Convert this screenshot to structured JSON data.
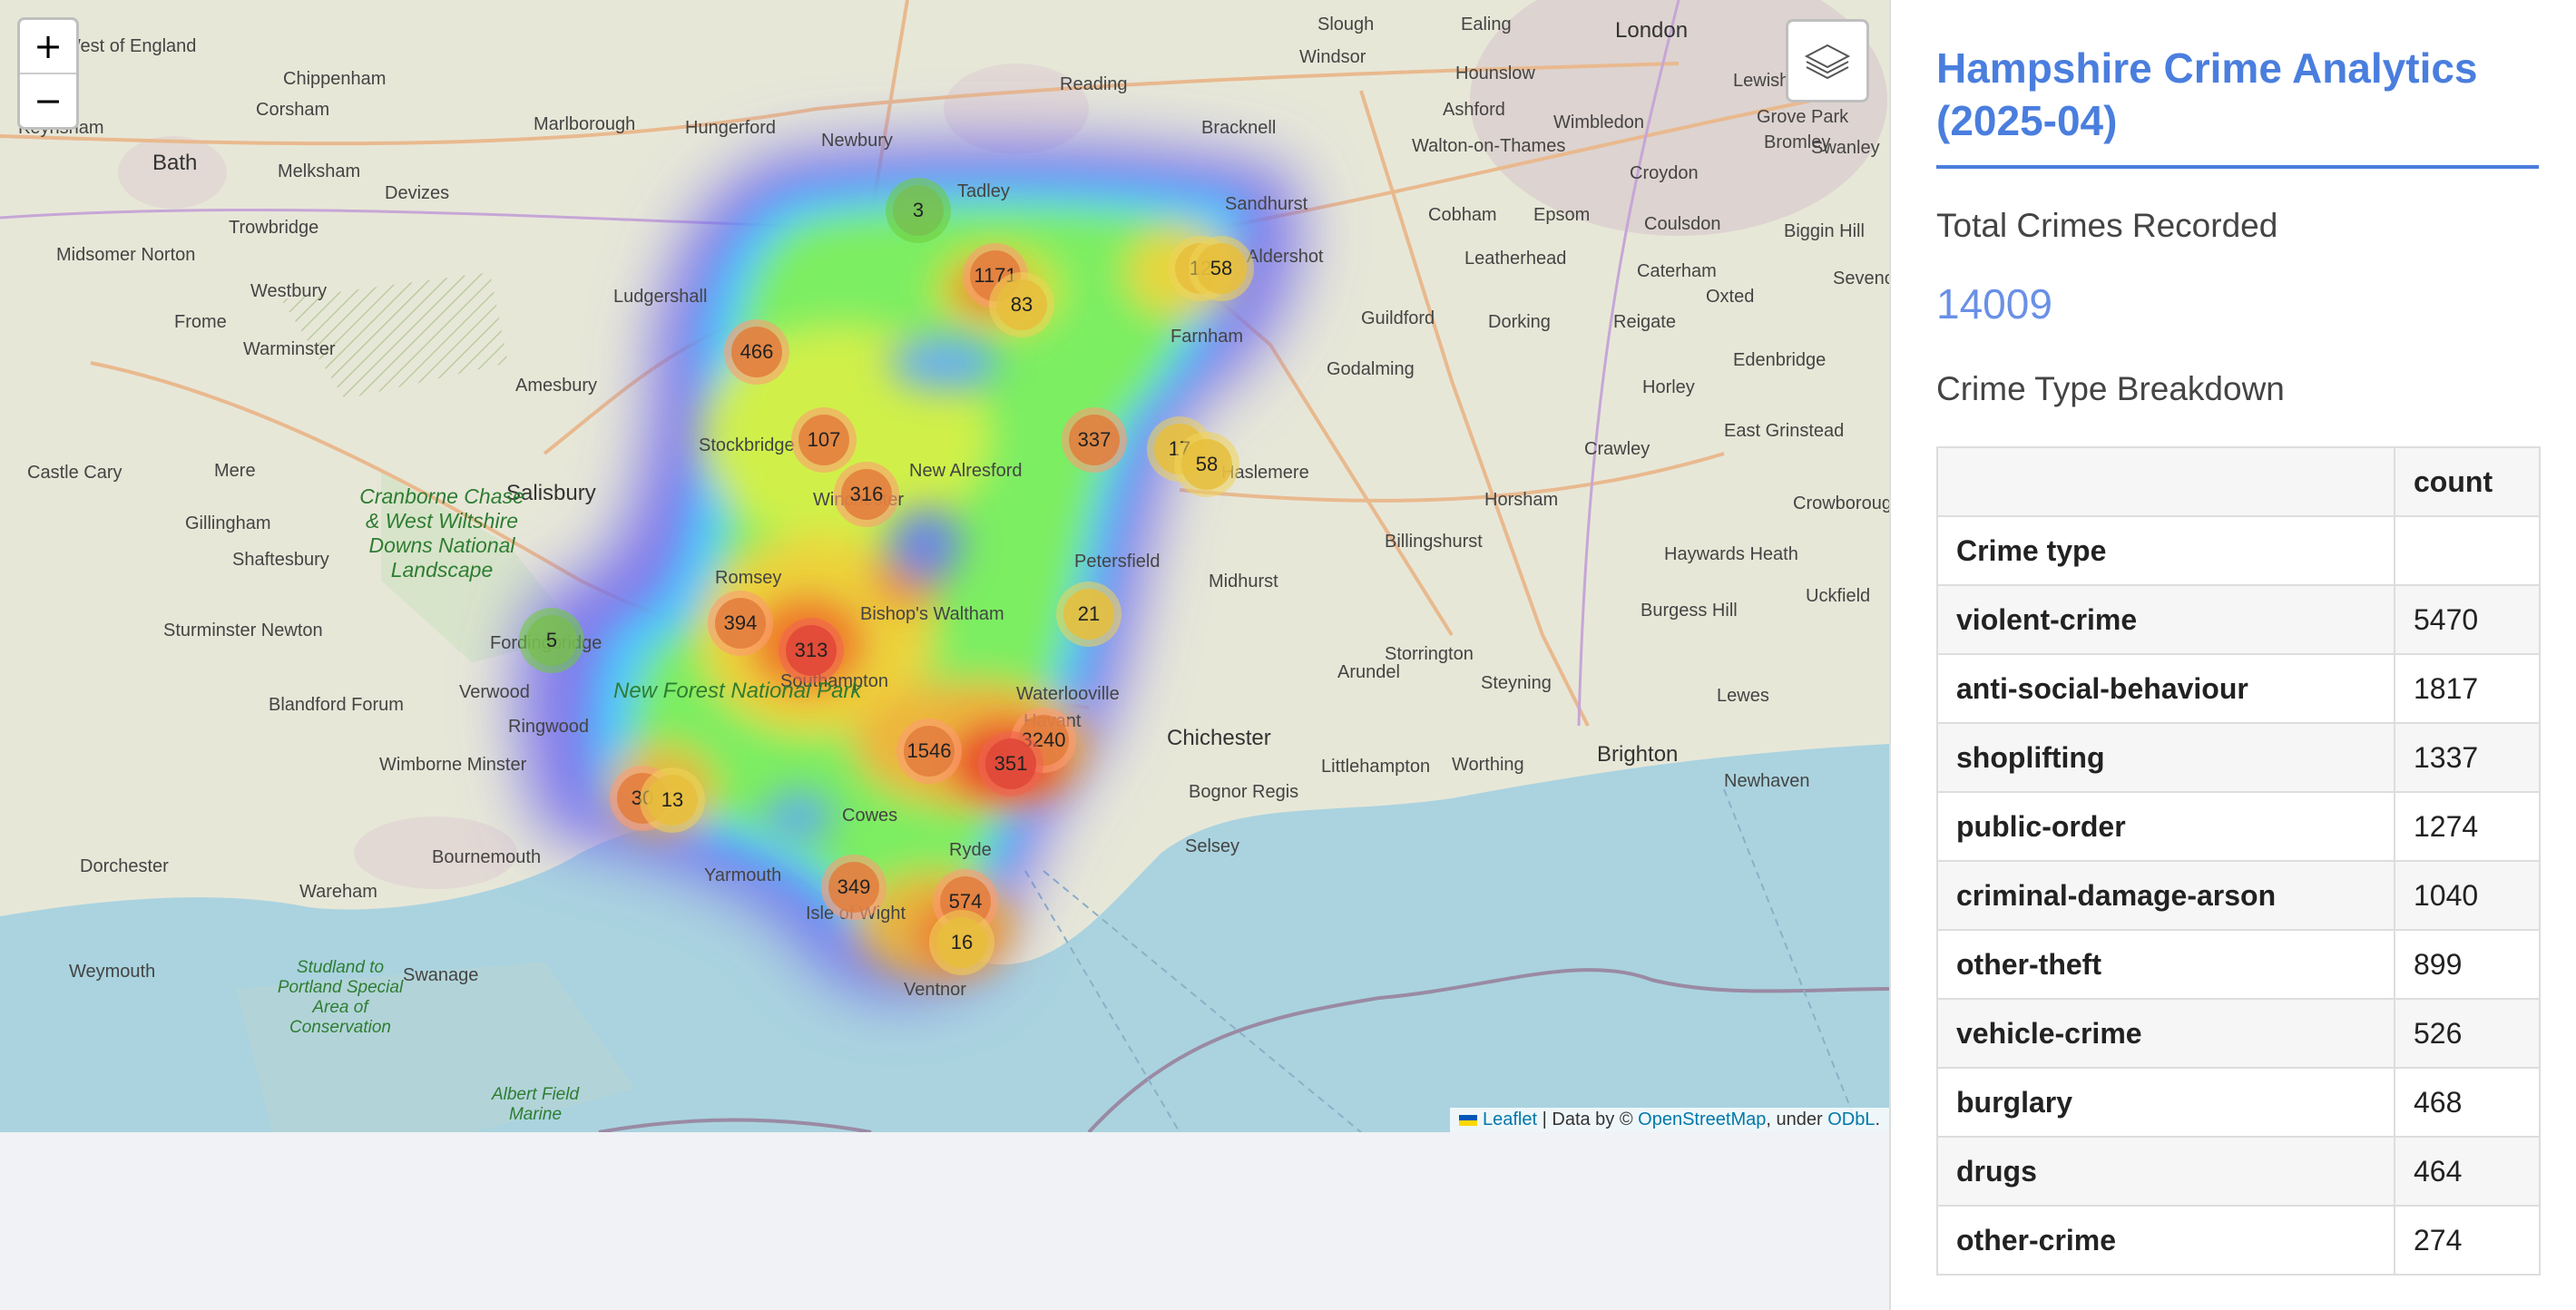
{
  "map": {
    "zoom_in": "+",
    "zoom_out": "−",
    "layers_icon": "layers-icon",
    "places": [
      "London",
      "Ealing",
      "Slough",
      "Windsor",
      "Hounslow",
      "Wimbledon",
      "Croydon",
      "Reading",
      "Newbury",
      "Bracknell",
      "Ashford",
      "Walton-on-Thames",
      "Lewisham",
      "Grove Park",
      "Bromley",
      "Swanley",
      "Chippenham",
      "Corsham",
      "Marlborough",
      "Hungerford",
      "Tadley",
      "Sandhurst",
      "Aldershot",
      "Farnham",
      "Guildford",
      "Godalming",
      "Cobham",
      "Epsom",
      "Leatherhead",
      "Dorking",
      "Reigate",
      "Coulsdon",
      "Caterham",
      "Oxted",
      "Biggin Hill",
      "Sevenoaks",
      "Edenbridge",
      "Horley",
      "East Grinstead",
      "Crawley",
      "Crowborough",
      "Bath",
      "Melksham",
      "Devizes",
      "Trowbridge",
      "Midsomer Norton",
      "Westbury",
      "Frome",
      "Warminster",
      "Ludgershall",
      "Amesbury",
      "Salisbury",
      "Stockbridge",
      "New Alresford",
      "Winchester",
      "Romsey",
      "Bishop's Waltham",
      "Petersfield",
      "Haslemere",
      "Midhurst",
      "Horsham",
      "Billingshurst",
      "Haywards Heath",
      "Burgess Hill",
      "Uckfield",
      "Lewes",
      "Steyning",
      "Storrington",
      "Chichester",
      "Arundel",
      "Littlehampton",
      "Worthing",
      "Brighton",
      "Newhaven",
      "Bognor Regis",
      "Selsey",
      "Castle Cary",
      "Mere",
      "Gillingham",
      "Shaftesbury",
      "Sturminster Newton",
      "Blandford Forum",
      "Verwood",
      "Ringwood",
      "Fordingbridge",
      "Wimborne Minster",
      "Bournemouth",
      "Dorchester",
      "Wareham",
      "Swanage",
      "Weymouth",
      "Yarmouth",
      "Cowes",
      "Ryde",
      "Ventnor",
      "Isle of Wight",
      "Waterlooville",
      "Havant",
      "Southampton",
      "New Forest National Park",
      "Cranborne Chase & West Wiltshire Downs National Landscape",
      "Studland to Portland Special Area of Conservation",
      "Albert Field Marine",
      "West of England",
      "Keynsham"
    ],
    "clusters": [
      {
        "label": "3",
        "level": "low"
      },
      {
        "label": "1171",
        "level": "high"
      },
      {
        "label": "83",
        "level": "med"
      },
      {
        "label": "12",
        "level": "med"
      },
      {
        "label": "58",
        "level": "med"
      },
      {
        "label": "466",
        "level": "high"
      },
      {
        "label": "107",
        "level": "high"
      },
      {
        "label": "316",
        "level": "high"
      },
      {
        "label": "337",
        "level": "high"
      },
      {
        "label": "17",
        "level": "med"
      },
      {
        "label": "58",
        "level": "med"
      },
      {
        "label": "394",
        "level": "high"
      },
      {
        "label": "313",
        "level": "vhigh"
      },
      {
        "label": "5",
        "level": "low"
      },
      {
        "label": "21",
        "level": "med"
      },
      {
        "label": "1546",
        "level": "high"
      },
      {
        "label": "3240",
        "level": "high"
      },
      {
        "label": "351",
        "level": "vhigh"
      },
      {
        "label": "30",
        "level": "high"
      },
      {
        "label": "13",
        "level": "med"
      },
      {
        "label": "349",
        "level": "high"
      },
      {
        "label": "574",
        "level": "high"
      },
      {
        "label": "16",
        "level": "med"
      }
    ],
    "attribution": {
      "leaflet": "Leaflet",
      "sep1": " | Data by © ",
      "osm": "OpenStreetMap",
      "sep2": ", under ",
      "odbl": "ODbL",
      "end": "."
    }
  },
  "sidebar": {
    "title": "Hampshire Crime Analytics (2025-04)",
    "total_label": "Total Crimes Recorded",
    "total_value": "14009",
    "breakdown_label": "Crime Type Breakdown",
    "table": {
      "count_header": "count",
      "index_header": "Crime type",
      "rows": [
        {
          "type": "violent-crime",
          "count": "5470"
        },
        {
          "type": "anti-social-behaviour",
          "count": "1817"
        },
        {
          "type": "shoplifting",
          "count": "1337"
        },
        {
          "type": "public-order",
          "count": "1274"
        },
        {
          "type": "criminal-damage-arson",
          "count": "1040"
        },
        {
          "type": "other-theft",
          "count": "899"
        },
        {
          "type": "vehicle-crime",
          "count": "526"
        },
        {
          "type": "burglary",
          "count": "468"
        },
        {
          "type": "drugs",
          "count": "464"
        },
        {
          "type": "other-crime",
          "count": "274"
        }
      ]
    }
  },
  "colors": {
    "accent": "#4a7ede",
    "sea": "#aad3df",
    "land": "#ebe7dd"
  }
}
